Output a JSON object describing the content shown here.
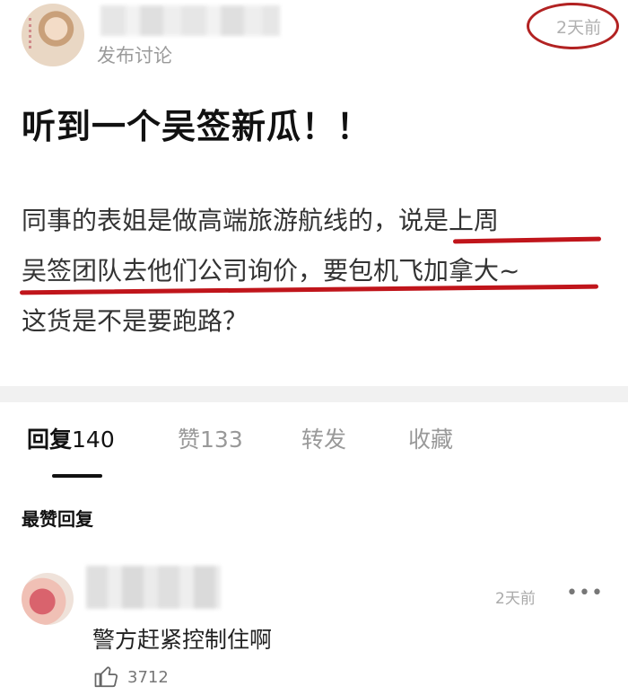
{
  "post": {
    "action": "发布讨论",
    "time": "2天前",
    "title": "听到一个吴签新瓜！！",
    "body_lines": [
      "同事的表姐是做高端旅游航线的，说是上周",
      "吴签团队去他们公司询价，要包机飞加拿大~",
      "这货是不是要跑路？"
    ]
  },
  "tabs": [
    {
      "label": "回复",
      "count": "140",
      "active": true
    },
    {
      "label": "赞",
      "count": "133",
      "active": false
    },
    {
      "label": "转发",
      "count": "",
      "active": false
    },
    {
      "label": "收藏",
      "count": "",
      "active": false
    }
  ],
  "hot_replies_header": "最赞回复",
  "comment": {
    "time": "2天前",
    "text": "警方赶紧控制住啊",
    "likes": "3712"
  },
  "colors": {
    "annotation_red": "#c0151b",
    "muted_text": "#9a9a9a"
  },
  "icons": {
    "more": "more-horizontal-icon",
    "like": "thumbs-up-icon"
  }
}
